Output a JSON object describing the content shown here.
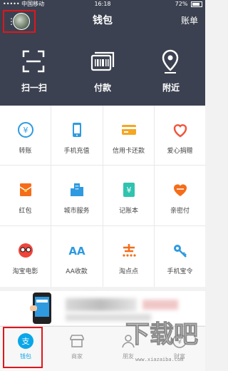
{
  "status_bar": {
    "carrier": "••••• 中国移动",
    "time": "16:18",
    "battery": "72%"
  },
  "header": {
    "title": "钱包",
    "right_label": "账单"
  },
  "big_actions": [
    {
      "label": "扫一扫",
      "icon": "scan-icon"
    },
    {
      "label": "付款",
      "icon": "pay-code-icon"
    },
    {
      "label": "附近",
      "icon": "location-icon"
    }
  ],
  "services": [
    {
      "label": "转账",
      "icon": "transfer-icon"
    },
    {
      "label": "手机充值",
      "icon": "phone-recharge-icon"
    },
    {
      "label": "信用卡还款",
      "icon": "credit-card-icon"
    },
    {
      "label": "爱心捐赠",
      "icon": "charity-icon"
    },
    {
      "label": "红包",
      "icon": "red-envelope-icon"
    },
    {
      "label": "城市服务",
      "icon": "city-service-icon"
    },
    {
      "label": "记账本",
      "icon": "ledger-icon"
    },
    {
      "label": "亲密付",
      "icon": "family-pay-icon"
    },
    {
      "label": "淘宝电影",
      "icon": "taobao-movie-icon"
    },
    {
      "label": "AA收款",
      "icon": "aa-collect-icon"
    },
    {
      "label": "淘点点",
      "icon": "taodiandian-icon"
    },
    {
      "label": "手机宝令",
      "icon": "phone-token-icon"
    }
  ],
  "tabs": [
    {
      "label": "钱包",
      "icon": "wallet-icon",
      "active": true
    },
    {
      "label": "商家",
      "icon": "merchant-icon"
    },
    {
      "label": "朋友",
      "icon": "friends-icon"
    },
    {
      "label": "财富",
      "icon": "wealth-icon"
    }
  ],
  "colors": {
    "header_bg": "#3b4150",
    "accent_blue": "#2f9ae0",
    "accent_orange": "#f56d1a",
    "highlight_red": "#e0161b"
  },
  "watermark": {
    "main": "下载吧",
    "url": "www.xiazaiba.com"
  }
}
